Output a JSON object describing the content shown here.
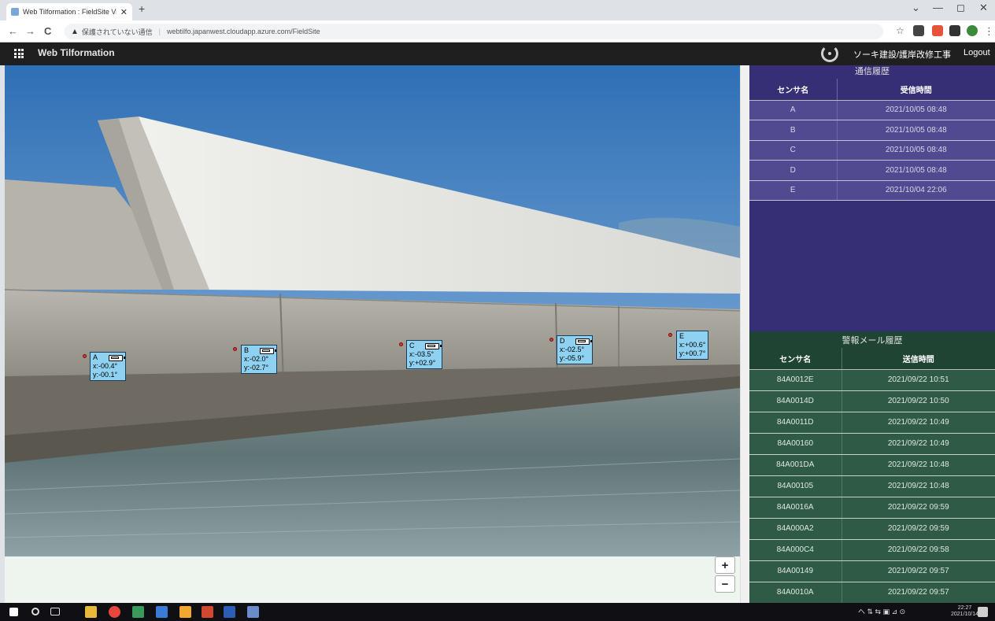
{
  "browser": {
    "tab_title": "Web Tilformation : FieldSite View",
    "tab_close": "✕",
    "new_tab": "+",
    "back": "←",
    "forward": "→",
    "reload": "C",
    "security_icon": "▲",
    "security_text": "保護されていない通信",
    "separator": "|",
    "url": "webtilfo.japanwest.cloudapp.azure.com/FieldSite",
    "star": "☆",
    "menu": "⋮",
    "minimize": "⌄",
    "restore": "—",
    "maximize": "◻",
    "close": "✕"
  },
  "app": {
    "title": "Web Tilformation",
    "company": "ソーキ建設/護岸改修工事",
    "logout": "Logout"
  },
  "sensors": [
    {
      "name": "A",
      "x": "x:-00.4°",
      "y": "y:-00.1°"
    },
    {
      "name": "B",
      "x": "x:-02.0°",
      "y": "y:-02.7°"
    },
    {
      "name": "C",
      "x": "x:-03.5°",
      "y": "y:+02.9°"
    },
    {
      "name": "D",
      "x": "x:-02.5°",
      "y": "y:-05.9°"
    },
    {
      "name": "E",
      "x": "x:+00.6°",
      "y": "y:+00.7°"
    }
  ],
  "map": {
    "zoom_in": "+",
    "zoom_out": "−"
  },
  "comm_history": {
    "title": "通信履歴",
    "col_sensor": "センサ名",
    "col_time": "受信時間",
    "rows": [
      {
        "sensor": "A",
        "time": "2021/10/05 08:48"
      },
      {
        "sensor": "B",
        "time": "2021/10/05 08:48"
      },
      {
        "sensor": "C",
        "time": "2021/10/05 08:48"
      },
      {
        "sensor": "D",
        "time": "2021/10/05 08:48"
      },
      {
        "sensor": "E",
        "time": "2021/10/04 22:06"
      }
    ]
  },
  "alert_history": {
    "title": "警報メール履歴",
    "col_sensor": "センサ名",
    "col_time": "送信時間",
    "rows": [
      {
        "sensor": "84A0012E",
        "time": "2021/09/22 10:51"
      },
      {
        "sensor": "84A0014D",
        "time": "2021/09/22 10:50"
      },
      {
        "sensor": "84A0011D",
        "time": "2021/09/22 10:49"
      },
      {
        "sensor": "84A00160",
        "time": "2021/09/22 10:49"
      },
      {
        "sensor": "84A001DA",
        "time": "2021/09/22 10:48"
      },
      {
        "sensor": "84A00105",
        "time": "2021/09/22 10:48"
      },
      {
        "sensor": "84A0016A",
        "time": "2021/09/22 09:59"
      },
      {
        "sensor": "84A000A2",
        "time": "2021/09/22 09:59"
      },
      {
        "sensor": "84A000C4",
        "time": "2021/09/22 09:58"
      },
      {
        "sensor": "84A00149",
        "time": "2021/09/22 09:57"
      },
      {
        "sensor": "84A0010A",
        "time": "2021/09/22 09:57"
      }
    ]
  },
  "taskbar": {
    "tray": "へ ⇅ ⇆ ▣ ⊿ ⊙",
    "time": "22:27",
    "date": "2021/10/14"
  }
}
